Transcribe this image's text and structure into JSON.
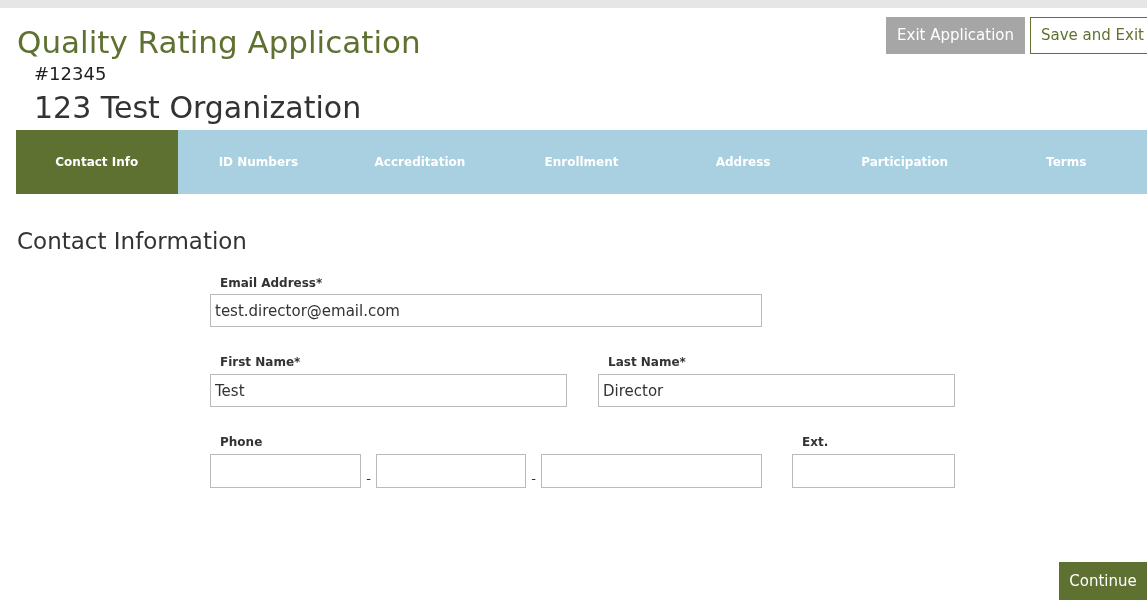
{
  "header": {
    "title": "Quality Rating Application",
    "application_number": "#12345",
    "organization": "123 Test Organization"
  },
  "actions": [
    {
      "label": "Exit Application",
      "kind": "secondary"
    },
    {
      "label": "Save and Exit",
      "kind": "outline"
    }
  ],
  "tabs": [
    {
      "label": "Contact Info",
      "selected": true
    },
    {
      "label": "ID Numbers",
      "selected": false
    },
    {
      "label": "Accreditation",
      "selected": false
    },
    {
      "label": "Enrollment",
      "selected": false
    },
    {
      "label": "Address",
      "selected": false
    },
    {
      "label": "Participation",
      "selected": false
    },
    {
      "label": "Terms",
      "selected": false
    }
  ],
  "section_title": "Contact Information",
  "email": {
    "label": "Email Address*",
    "value": "test.director@email.com"
  },
  "first_name": {
    "label": "First Name*",
    "value": "Test"
  },
  "last_name": {
    "label": "Last Name*",
    "value": "Director"
  },
  "phone": {
    "label": "Phone",
    "separators": [
      "-",
      "-"
    ]
  },
  "ext": {
    "label": "Ext."
  },
  "continue_button": "Continue"
}
